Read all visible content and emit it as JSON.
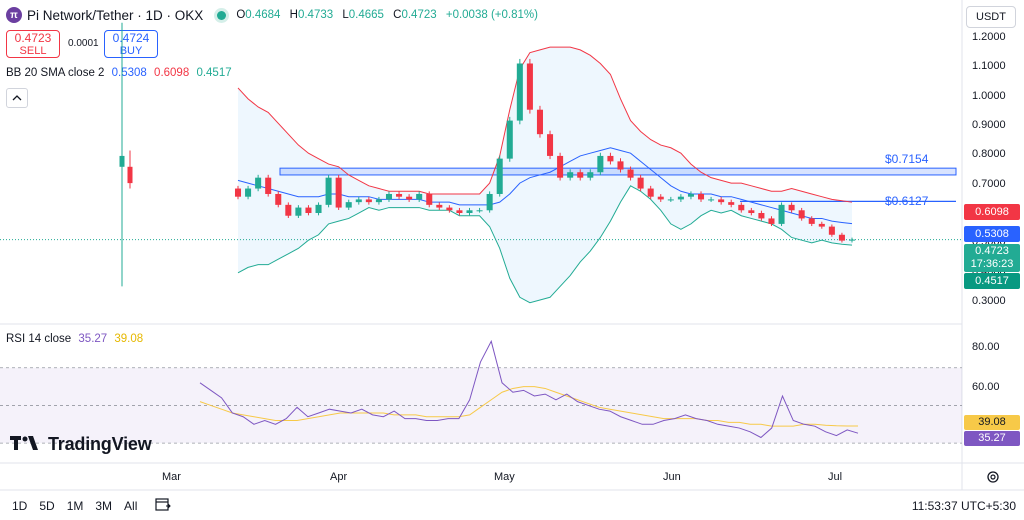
{
  "header": {
    "title": "Pi Network/Tether · 1D · OKX",
    "open_label": "O",
    "open": "0.4684",
    "high_label": "H",
    "high": "0.4733",
    "low_label": "L",
    "low": "0.4665",
    "close_label": "C",
    "close": "0.4723",
    "change": "+0.0038 (+0.81%)"
  },
  "trade": {
    "sell_price": "0.4723",
    "sell_label": "SELL",
    "buy_price": "0.4724",
    "buy_label": "BUY",
    "spread": "0.0001"
  },
  "bb": {
    "label": "BB 20 SMA close 2",
    "basis": "0.5308",
    "upper": "0.6098",
    "lower": "0.4517"
  },
  "rsi": {
    "label": "RSI 14 close",
    "value": "35.27",
    "ma": "39.08"
  },
  "currency": "USDT",
  "price_axis": [
    "1.2000",
    "1.1000",
    "1.0000",
    "0.9000",
    "0.8000",
    "0.7000",
    "0.6000",
    "0.5000",
    "0.4000",
    "0.3000"
  ],
  "rsi_axis": [
    "80.00",
    "60.00"
  ],
  "price_badges": {
    "upper": "0.6098",
    "basis": "0.5308",
    "last": "0.4723",
    "countdown": "17:36:23",
    "lower": "0.4517"
  },
  "rsi_badges": {
    "ma": "39.08",
    "rsi": "35.27"
  },
  "annotations": {
    "zone_label": "$0.7154",
    "line_label": "$0.6127"
  },
  "x_axis": [
    "Mar",
    "Apr",
    "May",
    "Jun",
    "Jul"
  ],
  "brand": "TradingView",
  "ranges": [
    "1D",
    "5D",
    "1M",
    "3M",
    "All"
  ],
  "clock": "11:53:37 UTC+5:30",
  "colors": {
    "up": "#22ab94",
    "down": "#f23645",
    "basis": "#2962ff",
    "upper": "#f23645",
    "lower": "#22ab94",
    "rsi": "#7e57c2",
    "rsi_ma": "#f7c948",
    "zone": "#2962ff"
  },
  "chart_data": {
    "type": "candlestick",
    "ylim": [
      0.25,
      1.28
    ],
    "series": [
      {
        "name": "open",
        "values": [
          0.66,
          0.63,
          0.66,
          0.7,
          0.64,
          0.6,
          0.56,
          0.59,
          0.57,
          0.6,
          0.7,
          0.59,
          0.61,
          0.62,
          0.61,
          0.62,
          0.64,
          0.63,
          0.62,
          0.64,
          0.6,
          0.59,
          0.58,
          0.57,
          0.58,
          0.58,
          0.64,
          0.77,
          0.91,
          1.12,
          0.95,
          0.86,
          0.78,
          0.7,
          0.72,
          0.7,
          0.72,
          0.78,
          0.76,
          0.73,
          0.7,
          0.66,
          0.63,
          0.62,
          0.62,
          0.63,
          0.64,
          0.62,
          0.62,
          0.61,
          0.6,
          0.58,
          0.57,
          0.55,
          0.53,
          0.6,
          0.58,
          0.55,
          0.53,
          0.52,
          0.49,
          0.4684
        ]
      },
      {
        "name": "close",
        "values": [
          0.63,
          0.66,
          0.7,
          0.64,
          0.6,
          0.56,
          0.59,
          0.57,
          0.6,
          0.7,
          0.59,
          0.61,
          0.62,
          0.61,
          0.62,
          0.64,
          0.63,
          0.62,
          0.64,
          0.6,
          0.59,
          0.58,
          0.57,
          0.58,
          0.58,
          0.64,
          0.77,
          0.91,
          1.12,
          0.95,
          0.86,
          0.78,
          0.7,
          0.72,
          0.7,
          0.72,
          0.78,
          0.76,
          0.73,
          0.7,
          0.66,
          0.63,
          0.62,
          0.62,
          0.63,
          0.64,
          0.62,
          0.62,
          0.61,
          0.6,
          0.58,
          0.57,
          0.55,
          0.53,
          0.6,
          0.58,
          0.55,
          0.53,
          0.52,
          0.49,
          0.4684,
          0.4723
        ]
      },
      {
        "name": "BB basis",
        "values": [
          0.69,
          0.68,
          0.67,
          0.66,
          0.65,
          0.64,
          0.63,
          0.63,
          0.63,
          0.64,
          0.64,
          0.63,
          0.63,
          0.63,
          0.62,
          0.62,
          0.62,
          0.62,
          0.62,
          0.61,
          0.61,
          0.61,
          0.6,
          0.6,
          0.6,
          0.6,
          0.61,
          0.64,
          0.68,
          0.7,
          0.71,
          0.72,
          0.74,
          0.76,
          0.78,
          0.79,
          0.8,
          0.81,
          0.8,
          0.79,
          0.76,
          0.73,
          0.7,
          0.67,
          0.65,
          0.64,
          0.64,
          0.64,
          0.63,
          0.63,
          0.62,
          0.61,
          0.6,
          0.59,
          0.58,
          0.57,
          0.56,
          0.55,
          0.55,
          0.54,
          0.535,
          0.5308
        ]
      },
      {
        "name": "BB upper",
        "values": [
          1.03,
          0.99,
          0.96,
          0.94,
          0.9,
          0.86,
          0.82,
          0.79,
          0.77,
          0.75,
          0.74,
          0.71,
          0.69,
          0.67,
          0.66,
          0.65,
          0.65,
          0.65,
          0.65,
          0.64,
          0.64,
          0.64,
          0.64,
          0.64,
          0.64,
          0.68,
          0.78,
          0.95,
          1.1,
          1.16,
          1.17,
          1.18,
          1.18,
          1.18,
          1.17,
          1.15,
          1.12,
          1.08,
          0.99,
          0.91,
          0.87,
          0.84,
          0.82,
          0.81,
          0.79,
          0.75,
          0.72,
          0.7,
          0.69,
          0.68,
          0.68,
          0.67,
          0.66,
          0.65,
          0.65,
          0.66,
          0.65,
          0.64,
          0.63,
          0.62,
          0.615,
          0.6098
        ]
      },
      {
        "name": "BB lower",
        "values": [
          0.35,
          0.37,
          0.38,
          0.38,
          0.4,
          0.42,
          0.44,
          0.47,
          0.49,
          0.53,
          0.54,
          0.55,
          0.57,
          0.59,
          0.58,
          0.59,
          0.59,
          0.59,
          0.59,
          0.58,
          0.58,
          0.58,
          0.56,
          0.56,
          0.56,
          0.52,
          0.44,
          0.33,
          0.26,
          0.24,
          0.25,
          0.26,
          0.3,
          0.34,
          0.39,
          0.43,
          0.48,
          0.54,
          0.61,
          0.67,
          0.65,
          0.62,
          0.58,
          0.53,
          0.51,
          0.53,
          0.56,
          0.58,
          0.57,
          0.58,
          0.56,
          0.55,
          0.54,
          0.53,
          0.51,
          0.48,
          0.47,
          0.46,
          0.47,
          0.46,
          0.455,
          0.4517
        ]
      },
      {
        "name": "RSI",
        "values": [
          62,
          58,
          54,
          46,
          44,
          40,
          42,
          40,
          43,
          49,
          44,
          46,
          48,
          47,
          46,
          48,
          45,
          44,
          47,
          43,
          43,
          42,
          42,
          43,
          43,
          53,
          73,
          84,
          62,
          57,
          58,
          55,
          56,
          53,
          56,
          52,
          50,
          48,
          47,
          44,
          42,
          40,
          40,
          42,
          43,
          45,
          43,
          42,
          40,
          39,
          38,
          36,
          33,
          38,
          55,
          42,
          40,
          39,
          36,
          34,
          37,
          35.27
        ]
      },
      {
        "name": "RSI MA",
        "values": [
          52,
          50,
          48,
          46,
          45,
          44,
          43,
          42,
          42,
          42,
          43,
          44,
          45,
          46,
          46,
          46,
          46,
          46,
          45,
          45,
          45,
          44,
          44,
          44,
          44,
          45,
          49,
          53,
          57,
          59,
          60,
          60,
          59,
          57,
          55,
          53,
          51,
          49,
          48,
          47,
          46,
          45,
          44,
          43,
          43,
          43,
          43,
          42,
          42,
          41,
          41,
          40,
          40,
          39,
          39,
          39,
          40,
          40,
          39.5,
          39.2,
          39.1,
          39.08
        ]
      }
    ],
    "zone": [
      0.71,
      0.735
    ],
    "level": 0.6127,
    "rsi_ylim": [
      20,
      90
    ],
    "rsi_levels": [
      70,
      50,
      30
    ]
  }
}
